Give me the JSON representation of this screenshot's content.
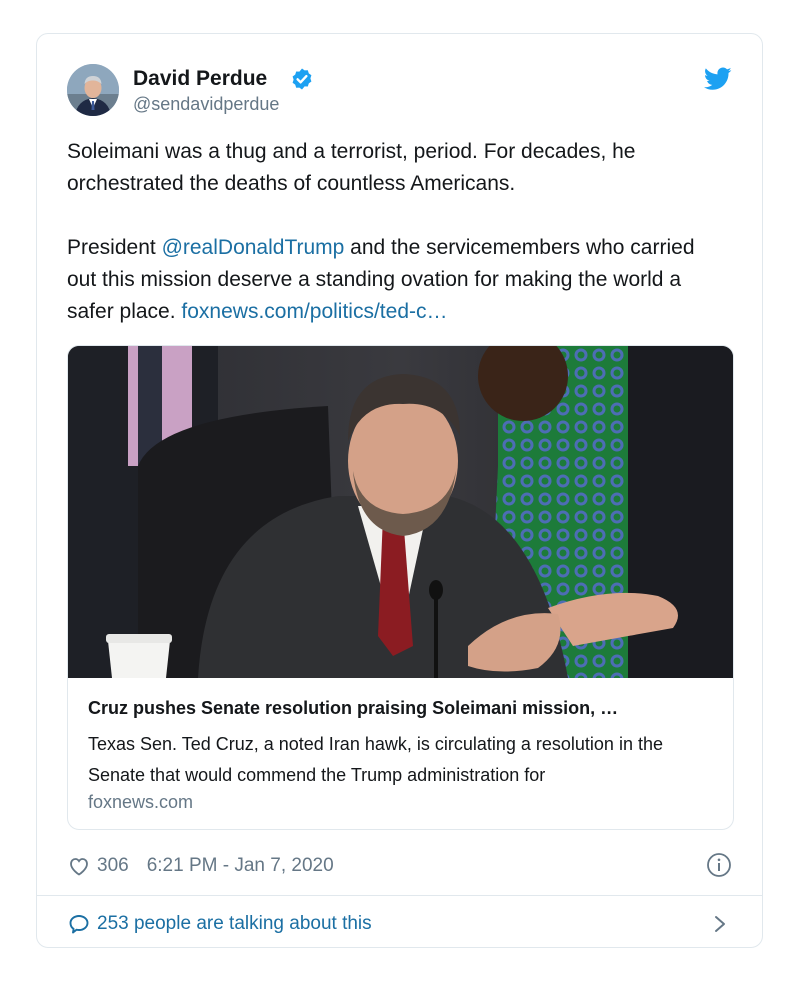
{
  "author": {
    "name": "David Perdue",
    "handle": "@sendavidperdue",
    "verified": true
  },
  "tweet": {
    "paragraph1": "Soleimani was a thug and a terrorist, period. For decades, he orchestrated the deaths of countless Americans.",
    "paragraph2_before": "President ",
    "mention": "@realDonaldTrump",
    "paragraph2_after": " and the servicemembers who carried out this mission deserve a standing ovation for making the world a safer place. ",
    "link": "foxnews.com/politics/ted-c…"
  },
  "link_card": {
    "title": "Cruz pushes Senate resolution praising Soleimani mission, …",
    "description": "Texas Sen. Ted Cruz, a noted Iran hawk, is circulating a resolution in the Senate that would commend the Trump administration for",
    "domain": "foxnews.com"
  },
  "meta": {
    "likes": "306",
    "timestamp": "6:21 PM - Jan 7, 2020"
  },
  "footer": {
    "talking": "253 people are talking about this"
  },
  "colors": {
    "link": "#1b6fa3",
    "verified": "#1da1f2",
    "twitter": "#1da1f2",
    "muted": "#657786",
    "border": "#e1e8ed"
  },
  "icons": [
    "verified-badge-icon",
    "twitter-bird-icon",
    "heart-icon",
    "info-icon",
    "speech-bubble-icon",
    "chevron-right-icon"
  ]
}
